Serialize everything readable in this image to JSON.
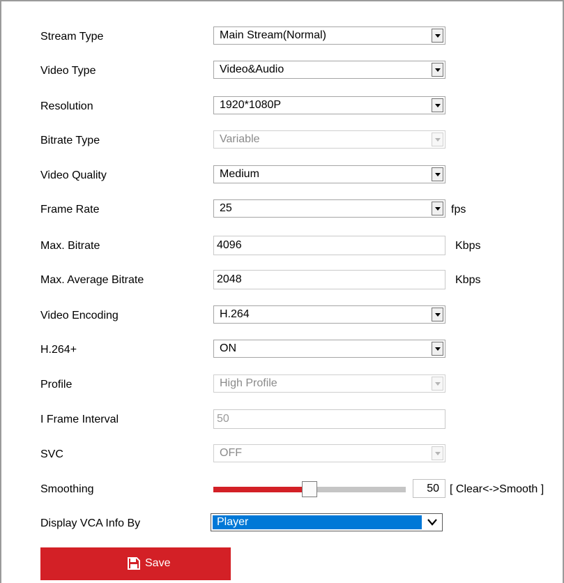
{
  "fields": {
    "stream_type": {
      "label": "Stream Type",
      "value": "Main Stream(Normal)"
    },
    "video_type": {
      "label": "Video Type",
      "value": "Video&Audio"
    },
    "resolution": {
      "label": "Resolution",
      "value": "1920*1080P"
    },
    "bitrate_type": {
      "label": "Bitrate Type",
      "value": "Variable"
    },
    "video_quality": {
      "label": "Video Quality",
      "value": "Medium"
    },
    "frame_rate": {
      "label": "Frame Rate",
      "value": "25",
      "unit": "fps"
    },
    "max_bitrate": {
      "label": "Max. Bitrate",
      "value": "4096",
      "unit": "Kbps"
    },
    "max_avg_bitrate": {
      "label": "Max. Average Bitrate",
      "value": "2048",
      "unit": "Kbps"
    },
    "video_encoding": {
      "label": "Video Encoding",
      "value": "H.264"
    },
    "h264_plus": {
      "label": "H.264+",
      "value": "ON"
    },
    "profile": {
      "label": "Profile",
      "value": "High Profile"
    },
    "i_frame_interval": {
      "label": "I Frame Interval",
      "value": "50"
    },
    "svc": {
      "label": "SVC",
      "value": "OFF"
    },
    "smoothing": {
      "label": "Smoothing",
      "value": "50",
      "min": 0,
      "max": 100,
      "hint": "[ Clear<->Smooth ]"
    },
    "display_vca": {
      "label": "Display VCA Info By",
      "value": "Player"
    }
  },
  "save_button": {
    "label": "Save",
    "icon": "save-icon"
  },
  "colors": {
    "accent": "#d32026",
    "highlight": "#0078d7"
  }
}
